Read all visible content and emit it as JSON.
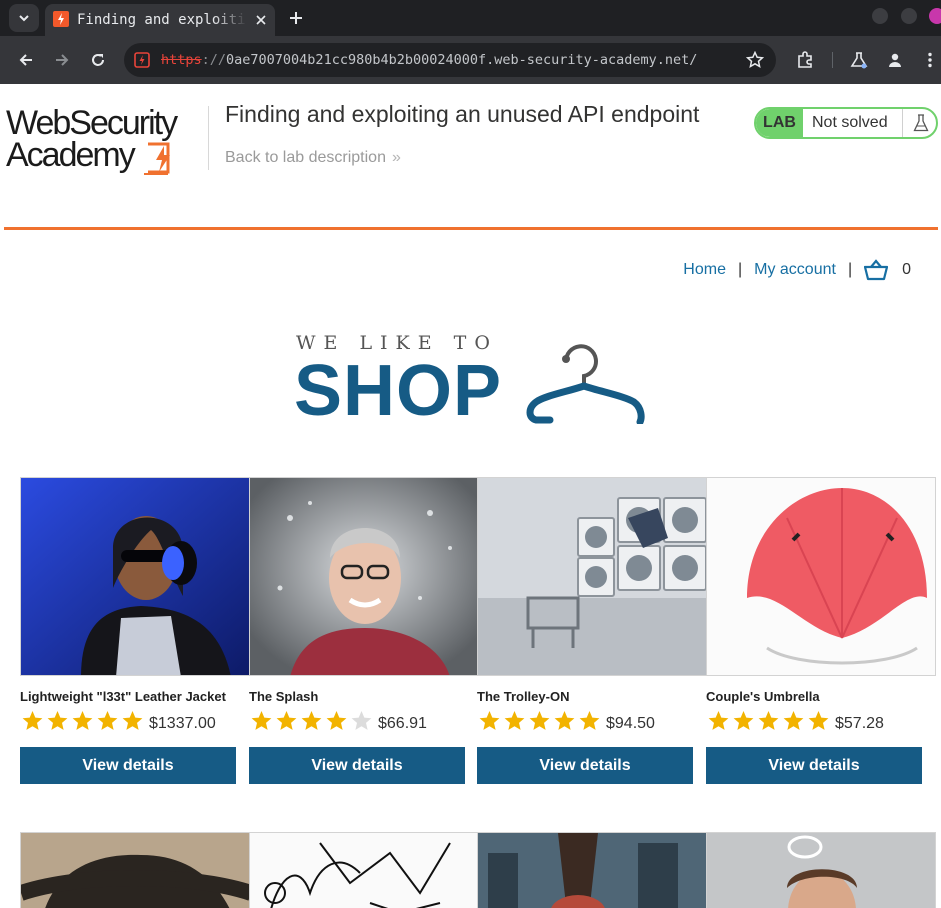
{
  "browser": {
    "tab": {
      "title": "Finding and exploiting an unused API endpoint"
    },
    "url": {
      "scheme": "https",
      "separator": "://",
      "rest": "0ae7007004b21cc980b4b2b00024000f.web-security-academy.net/"
    }
  },
  "header": {
    "logo": {
      "line1": "WebSecurity",
      "line2": "Academy"
    },
    "lab_title": "Finding and exploiting an unused API endpoint",
    "back_link": "Back to lab description",
    "back_chevron": "»",
    "status": {
      "badge": "LAB",
      "text": "Not solved"
    }
  },
  "nav": {
    "home": "Home",
    "separator": "|",
    "my_account": "My account",
    "cart_count": "0"
  },
  "banner": {
    "tagline": "WE LIKE TO",
    "word": "SHOP"
  },
  "products": [
    {
      "name": "Lightweight \"l33t\" Leather Jacket",
      "rating": 5,
      "price": "$1337.00",
      "button": "View details"
    },
    {
      "name": "The Splash",
      "rating": 4,
      "price": "$66.91",
      "button": "View details"
    },
    {
      "name": "The Trolley-ON",
      "rating": 5,
      "price": "$94.50",
      "button": "View details"
    },
    {
      "name": "Couple's Umbrella",
      "rating": 5,
      "price": "$57.28",
      "button": "View details"
    }
  ],
  "colors": {
    "accent_blue": "#165b85",
    "link_blue": "#176fa3",
    "orange": "#f0712f",
    "status_green": "#70d16c",
    "star_gold": "#f2b300",
    "star_grey": "#dcdcdc"
  },
  "icons": [
    "tab-search-icon",
    "lightning-favicon-icon",
    "close-icon",
    "plus-icon",
    "back-arrow-icon",
    "forward-arrow-icon",
    "reload-icon",
    "not-secure-icon",
    "bookmark-star-icon",
    "extensions-icon",
    "labs-flask-icon",
    "profile-icon",
    "more-menu-icon",
    "flask-icon",
    "cart-icon",
    "hanger-icon",
    "star-icon"
  ]
}
